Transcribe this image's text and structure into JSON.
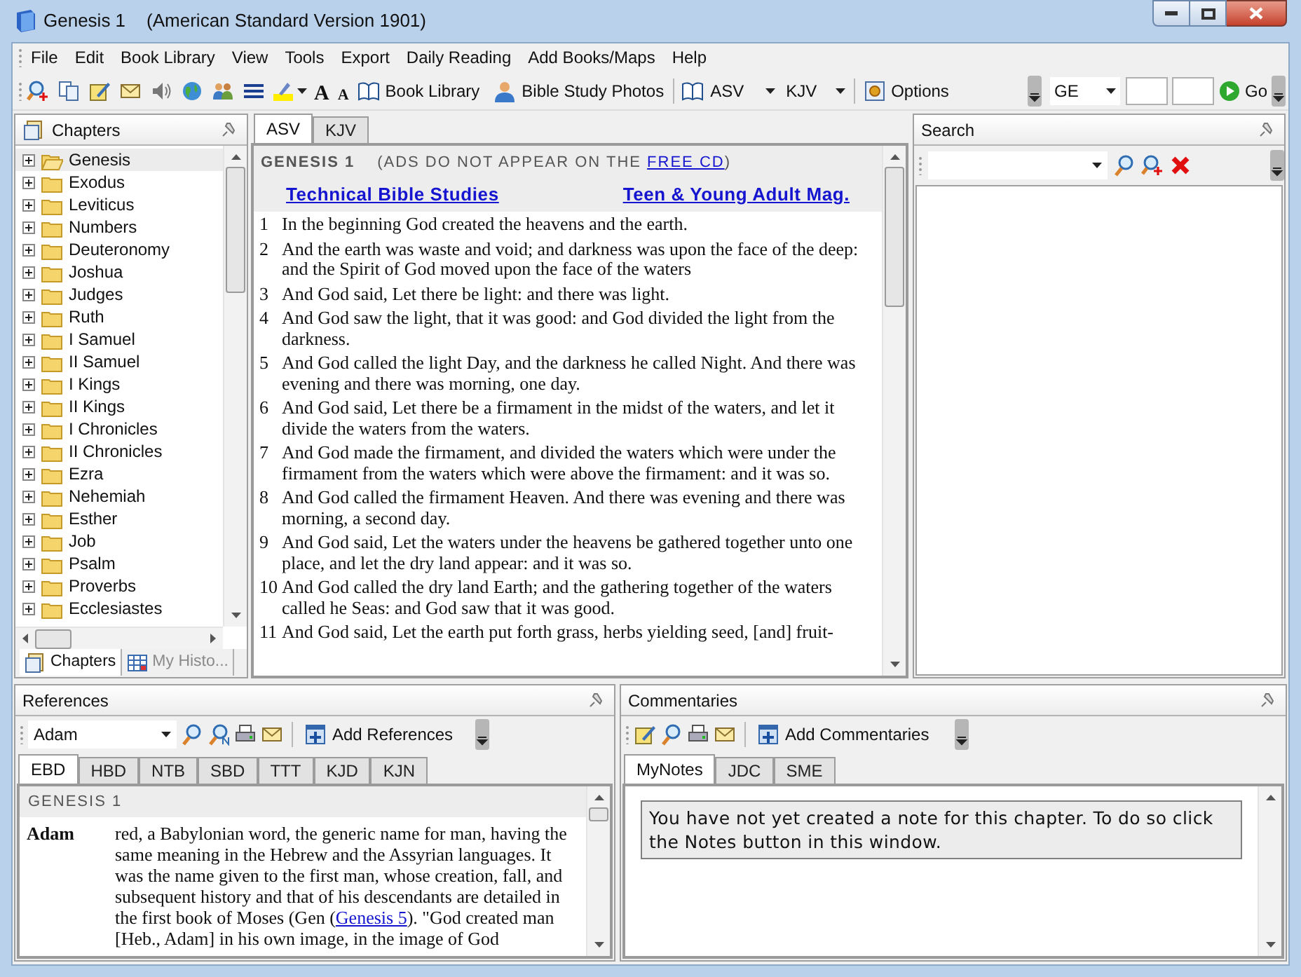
{
  "window": {
    "title": "Genesis 1",
    "subtitle": "(American Standard Version 1901)"
  },
  "menu": [
    "File",
    "Edit",
    "Book Library",
    "View",
    "Tools",
    "Export",
    "Daily Reading",
    "Add Books/Maps",
    "Help"
  ],
  "toolbar": {
    "font_larger": "A",
    "font_smaller": "A",
    "book_library": "Book Library",
    "photos": "Bible Study Photos",
    "version_a": "ASV",
    "version_b": "KJV",
    "options": "Options",
    "book": "GE",
    "go": "Go"
  },
  "chapters": {
    "title": "Chapters",
    "books": [
      {
        "label": "Genesis",
        "selected": true,
        "expanded": false
      },
      {
        "label": "Exodus",
        "selected": false,
        "expanded": false
      },
      {
        "label": "Leviticus",
        "selected": false,
        "expanded": false
      },
      {
        "label": "Numbers",
        "selected": false,
        "expanded": false
      },
      {
        "label": "Deuteronomy",
        "selected": false,
        "expanded": false
      },
      {
        "label": "Joshua",
        "selected": false,
        "expanded": false
      },
      {
        "label": "Judges",
        "selected": false,
        "expanded": false
      },
      {
        "label": "Ruth",
        "selected": false,
        "expanded": false
      },
      {
        "label": "I Samuel",
        "selected": false,
        "expanded": false
      },
      {
        "label": "II Samuel",
        "selected": false,
        "expanded": false
      },
      {
        "label": "I Kings",
        "selected": false,
        "expanded": false
      },
      {
        "label": "II Kings",
        "selected": false,
        "expanded": false
      },
      {
        "label": "I Chronicles",
        "selected": false,
        "expanded": false
      },
      {
        "label": "II Chronicles",
        "selected": false,
        "expanded": false
      },
      {
        "label": "Ezra",
        "selected": false,
        "expanded": false
      },
      {
        "label": "Nehemiah",
        "selected": false,
        "expanded": false
      },
      {
        "label": "Esther",
        "selected": false,
        "expanded": false
      },
      {
        "label": "Job",
        "selected": false,
        "expanded": false
      },
      {
        "label": "Psalm",
        "selected": false,
        "expanded": false
      },
      {
        "label": "Proverbs",
        "selected": false,
        "expanded": false
      },
      {
        "label": "Ecclesiastes",
        "selected": false,
        "expanded": false
      }
    ],
    "tabs": [
      {
        "label": "Chapters",
        "selected": true
      },
      {
        "label": "My Histo...",
        "selected": false
      }
    ]
  },
  "reader": {
    "tabs": [
      {
        "label": "ASV",
        "selected": true
      },
      {
        "label": "KJV",
        "selected": false
      }
    ],
    "heading": "GENESIS 1",
    "notice": "(ADS DO NOT APPEAR ON THE ",
    "notice_link": "FREE CD",
    "notice_end": ")",
    "ads": [
      "Technical Bible Studies",
      "Teen & Young Adult Mag."
    ],
    "verses": [
      {
        "number": "1",
        "text": "In the beginning God created the heavens and the earth."
      },
      {
        "number": "2",
        "text": "And the earth was waste and void; and darkness was upon the face of the deep: and the Spirit of God moved upon the face of the waters"
      },
      {
        "number": "3",
        "text": "And God said, Let there be light: and there was light."
      },
      {
        "number": "4",
        "text": "And God saw the light, that it was good: and God divided the light from the darkness."
      },
      {
        "number": "5",
        "text": "And God called the light Day, and the darkness he called Night. And there was evening and there was morning, one day."
      },
      {
        "number": "6",
        "text": "And God said, Let there be a firmament in the midst of the waters, and let it divide the waters from the waters."
      },
      {
        "number": "7",
        "text": "And God made the firmament, and divided the waters which were under the firmament from the waters which were above the firmament: and it was so."
      },
      {
        "number": "8",
        "text": "And God called the firmament Heaven. And there was evening and there was morning, a second day."
      },
      {
        "number": "9",
        "text": "And God said, Let the waters under the heavens be gathered together unto one place, and let the dry land appear: and it was so."
      },
      {
        "number": "10",
        "text": "And God called the dry land Earth; and the gathering together of the waters called he Seas: and God saw that it was good."
      },
      {
        "number": "11",
        "text": "And God said, Let the earth put forth grass, herbs yielding seed, [and] fruit-"
      }
    ]
  },
  "search": {
    "title": "Search"
  },
  "references": {
    "title": "References",
    "lookup": "Adam",
    "add": "Add References",
    "tabs": [
      {
        "label": "EBD",
        "selected": true
      },
      {
        "label": "HBD",
        "selected": false
      },
      {
        "label": "NTB",
        "selected": false
      },
      {
        "label": "SBD",
        "selected": false
      },
      {
        "label": "TTT",
        "selected": false
      },
      {
        "label": "KJD",
        "selected": false
      },
      {
        "label": "KJN",
        "selected": false
      }
    ],
    "heading": "GENESIS 1",
    "entry": {
      "term": "Adam",
      "text_before": "red, a Babylonian word, the generic name for man, having the same meaning in the Hebrew and the Assyrian languages. It was the name given to the first man, whose creation, fall, and subsequent history and that of his descendants are detailed in the first book of Moses (Gen (",
      "link": "Genesis 5",
      "text_after": "). \"God created man [Heb., Adam] in his own image, in the image of God"
    }
  },
  "commentaries": {
    "title": "Commentaries",
    "add": "Add Commentaries",
    "tabs": [
      {
        "label": "MyNotes",
        "selected": true
      },
      {
        "label": "JDC",
        "selected": false
      },
      {
        "label": "SME",
        "selected": false
      }
    ],
    "note": "You have not yet created a note for this chapter. To do so click the Notes button in this window."
  }
}
